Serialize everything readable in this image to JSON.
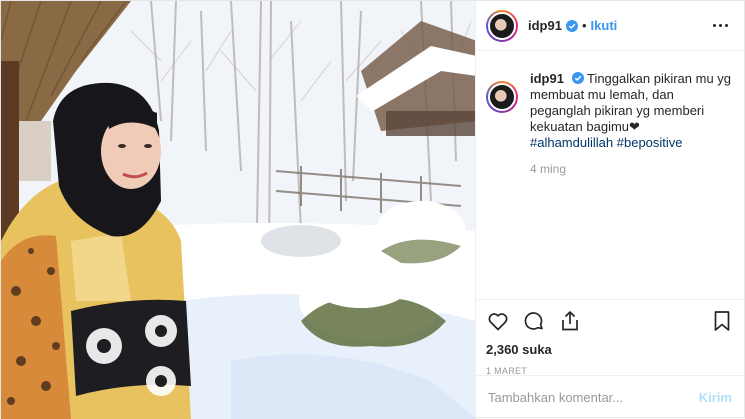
{
  "post": {
    "username": "idp91",
    "follow_label": "Ikuti",
    "dot": "•",
    "verified_icon": "verified-badge-icon",
    "caption": {
      "username": "idp91",
      "text": "Tinggalkan pikiran mu yg membuat mu lemah, dan peganglah pikiran yg memberi kekuatan bagimu❤",
      "hashtags": [
        "#alhamdulillah",
        "#bepositive"
      ],
      "time": "4 ming"
    },
    "actions": {
      "like_icon": "heart-icon",
      "comment_icon": "comment-icon",
      "share_icon": "share-icon",
      "save_icon": "bookmark-icon"
    },
    "likes": "2,360 suka",
    "date": "1 MARET",
    "comment_box": {
      "placeholder": "Tambahkan komentar...",
      "post_label": "Kirim"
    },
    "colors": {
      "link": "#3897f0",
      "hashtag": "#003569",
      "muted": "#999999",
      "post_disabled": "#b2dffc"
    }
  }
}
